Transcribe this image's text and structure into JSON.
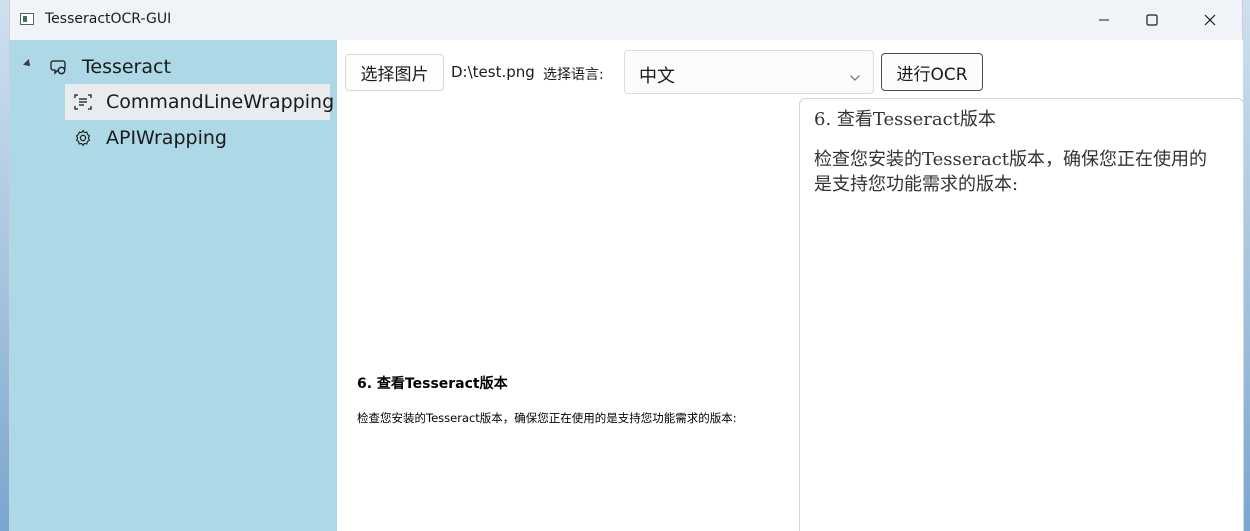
{
  "window": {
    "title": "TesseractOCR-GUI"
  },
  "sidebar": {
    "root": {
      "label": "Tesseract",
      "icon": "chat-icon"
    },
    "items": [
      {
        "label": "CommandLineWrapping",
        "icon": "scan-text-icon",
        "selected": true
      },
      {
        "label": "APIWrapping",
        "icon": "gear-icon",
        "selected": false
      }
    ]
  },
  "toolbar": {
    "select_image_label": "选择图片",
    "file_path": "D:\\test.png",
    "language_label": "选择语言:",
    "language_value": "中文",
    "run_ocr_label": "进行OCR"
  },
  "preview": {
    "heading": "6. 查看Tesseract版本",
    "body": "检查您安装的Tesseract版本，确保您正在使用的是支持您功能需求的版本:"
  },
  "result": {
    "heading": "6. 查看Tesseract版本",
    "body": "检查您安装的Tesseract版本，确保您正在使用的是支持您功能需求的版本:"
  }
}
